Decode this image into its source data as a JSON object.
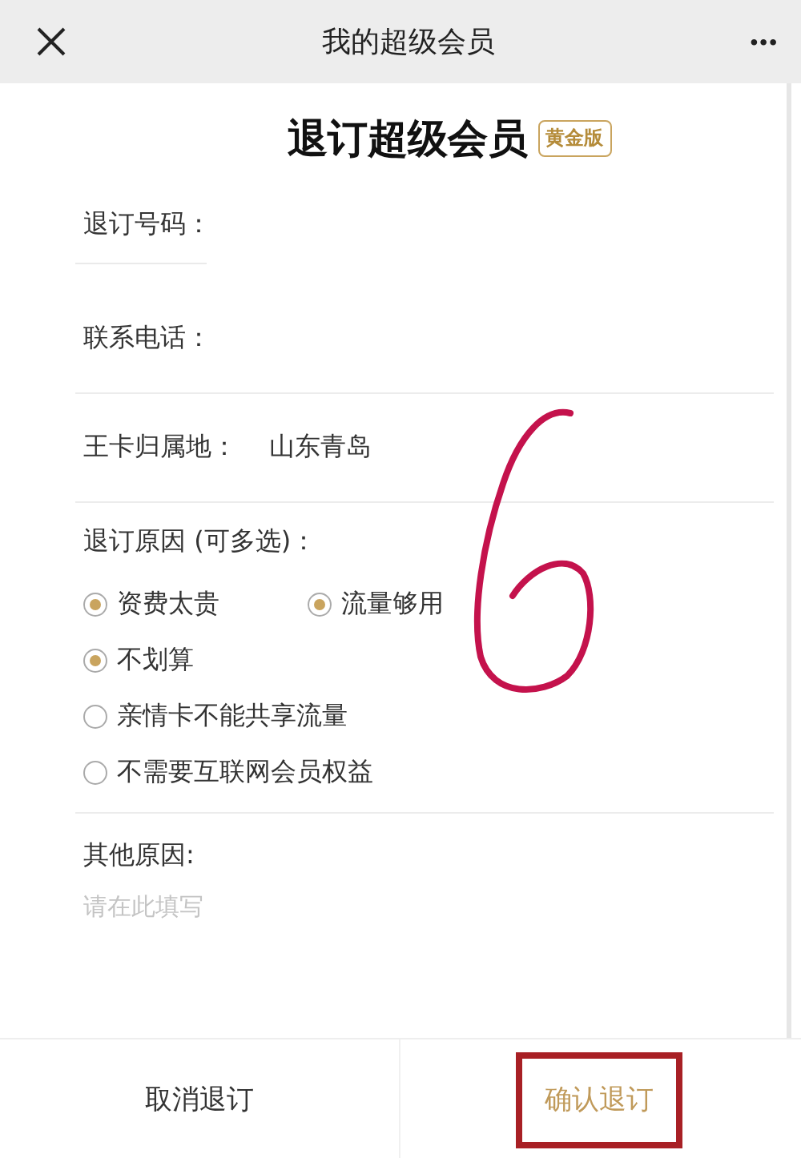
{
  "nav_bar": {
    "title": "我的超级会员",
    "more": "•••"
  },
  "heading": {
    "title": "退订超级会员",
    "badge": "黄金版"
  },
  "fields": [
    {
      "kind": "input",
      "label": "退订号码："
    },
    {
      "kind": "input",
      "label": "联系电话："
    },
    {
      "kind": "text",
      "label": "王卡归属地：",
      "value": "山东青岛"
    }
  ],
  "reasons": {
    "label": "退订原因 (可多选)：",
    "options": [
      {
        "label": "资费太贵",
        "checked": true
      },
      {
        "label": "流量够用",
        "checked": true
      },
      {
        "label": "不划算",
        "checked": true
      },
      {
        "label": "亲情卡不能共享流量",
        "checked": false
      },
      {
        "label": "不需要互联网会员权益",
        "checked": false
      }
    ]
  },
  "other": {
    "label": "其他原因:",
    "placeholder": "请在此填写"
  },
  "buttons": [
    {
      "kind": "cancel",
      "label": "取消退订"
    },
    {
      "kind": "confirm",
      "label": "确认退订"
    }
  ]
}
